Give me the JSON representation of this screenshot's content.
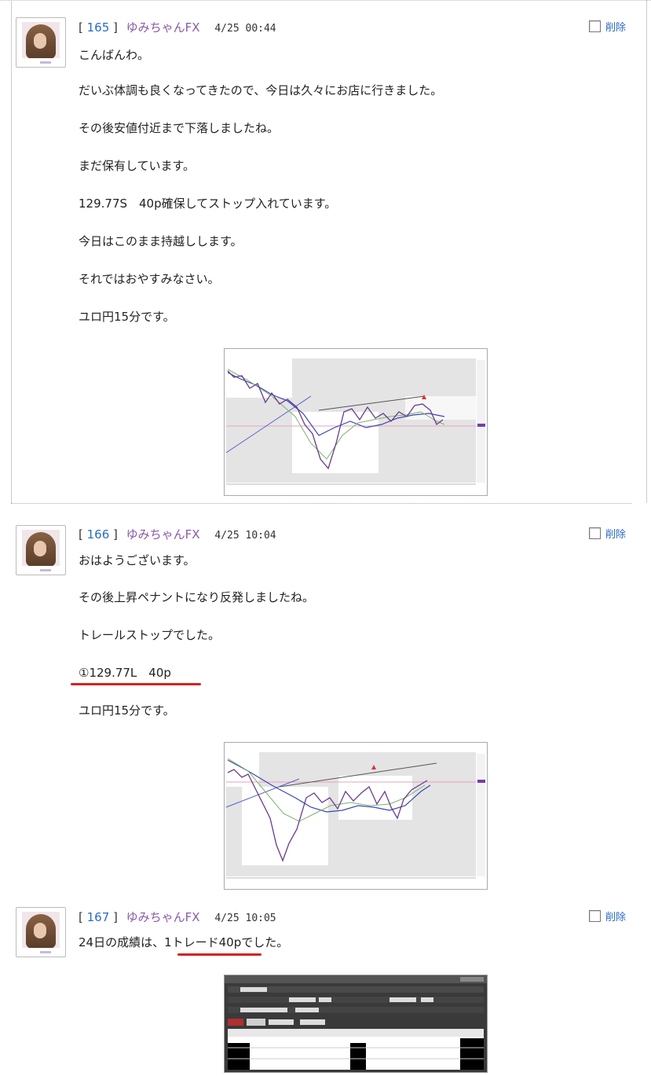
{
  "posts": [
    {
      "number": "165",
      "author": "ゆみちゃんFX",
      "date": "4/25 00:44",
      "delete_label": "削除",
      "lines": [
        "こんばんわ。",
        "だいぶ体調も良くなってきたので、今日は久々にお店に行きました。",
        "その後安値付近まで下落しましたね。",
        "まだ保有しています。",
        "129.77S　40p確保してストップ入れています。",
        "今日はこのまま持越しします。",
        "それではおやすみなさい。",
        "ユロ円15分です。"
      ]
    },
    {
      "number": "166",
      "author": "ゆみちゃんFX",
      "date": "4/25 10:04",
      "delete_label": "削除",
      "lines": [
        "おはようございます。",
        "その後上昇ペナントになり反発しましたね。",
        "トレールストップでした。",
        "①129.77L　40p",
        "ユロ円15分です。"
      ]
    },
    {
      "number": "167",
      "author": "ゆみちゃんFX",
      "date": "4/25 10:05",
      "delete_label": "削除",
      "lines": [
        "24日の成績は、1トレード40pでした。"
      ]
    }
  ],
  "colors": {
    "link": "#2a6cc4",
    "author": "#8a5aa8",
    "underline": "#d42222"
  }
}
